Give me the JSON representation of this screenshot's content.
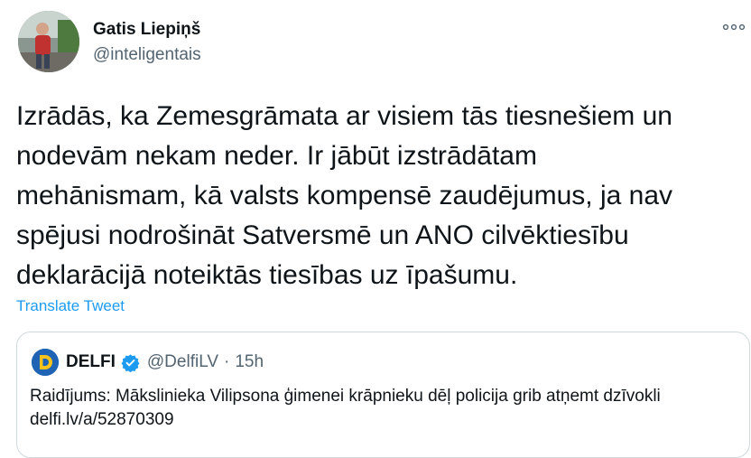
{
  "author": {
    "display_name": "Gatis Liepiņš",
    "handle": "@inteligentais"
  },
  "tweet": {
    "text": "Izrādās, ka Zemesgrāmata ar visiem tās tiesnešiem un\nnodevām nekam neder. Ir jābūt izstrādātam\nmehānismam, kā valsts kompensē zaudējumus, ja nav\nspējusi nodrošināt Satversmē un ANO cilvēktiesību\ndeklarācijā noteiktās tiesības uz īpašumu."
  },
  "translate_label": "Translate Tweet",
  "more_icon": "more-icon",
  "quoted": {
    "name": "DELFI",
    "handle": "@DelfiLV",
    "separator": "·",
    "time": "15h",
    "text": "Raidījums: Mākslinieka Vilipsona ģimenei krāpnieku dēļ policija grib atņemt dzīvokli ",
    "link": "delfi.lv/a/52870309"
  },
  "colors": {
    "accent": "#1d9bf0",
    "delfi_brand": "#1e63b4",
    "delfi_letter": "#f7c21b"
  }
}
